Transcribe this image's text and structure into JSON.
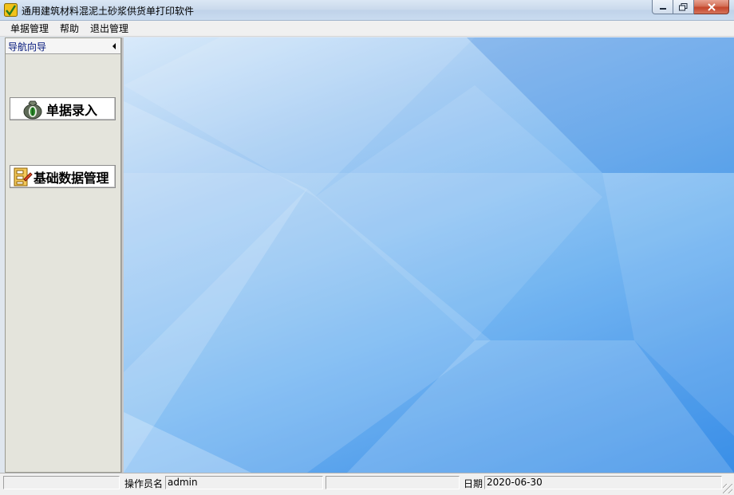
{
  "window": {
    "title": "通用建筑材料混泥土砂浆供货单打印软件",
    "controls": [
      "minimize",
      "maximize",
      "close"
    ]
  },
  "menu": {
    "items": [
      "单据管理",
      "帮助",
      "退出管理"
    ]
  },
  "navigation": {
    "title": "导航向导",
    "buttons": [
      {
        "label": "单据录入",
        "icon": "money-bag-icon"
      },
      {
        "label": "基础数据管理",
        "icon": "data-cabinet-icon"
      }
    ]
  },
  "status": {
    "operator_label": "操作员名",
    "operator_value": "admin",
    "date_label": "日期",
    "date_value": "2020-06-30"
  },
  "colors": {
    "background_light": "#d9eafa",
    "background_dark": "#1e7fe4",
    "nav_title": "#00157a"
  }
}
